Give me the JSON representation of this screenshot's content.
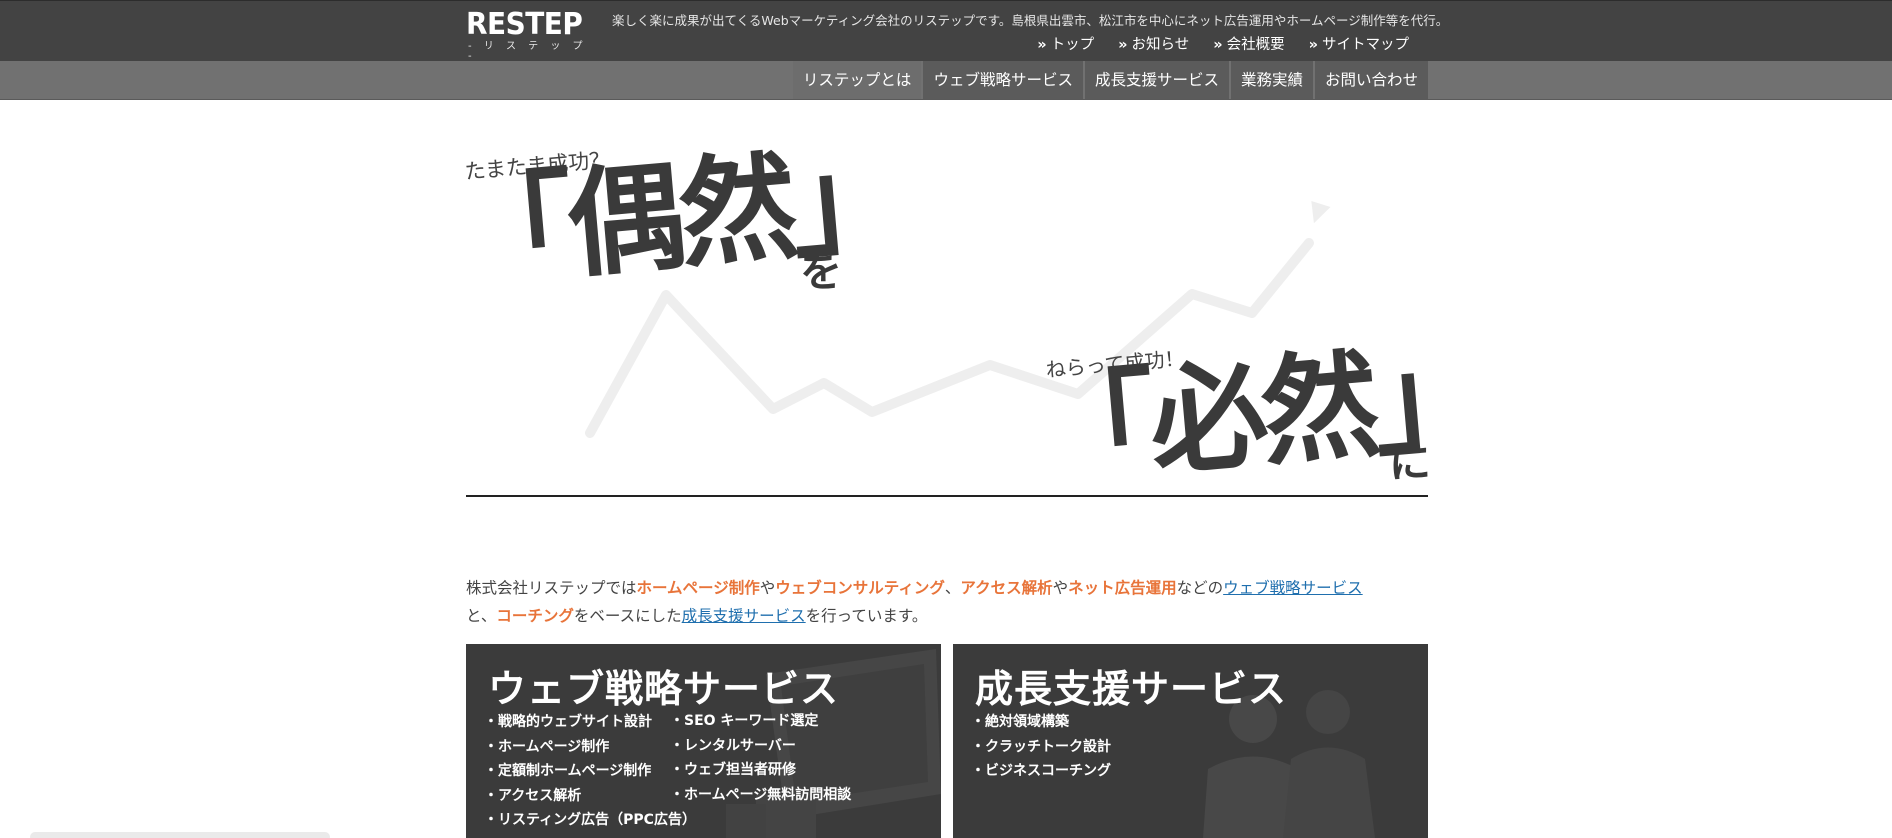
{
  "header": {
    "logo_main": "RESTEP",
    "logo_sub": "- リ ス テ ッ プ -",
    "tagline": "楽しく楽に成果が出てくるWebマーケティング会社のリステップです。島根県出雲市、松江市を中心にネット広告運用やホームページ制作等を代行。",
    "links": [
      {
        "label": "トップ"
      },
      {
        "label": "お知らせ"
      },
      {
        "label": "会社概要"
      },
      {
        "label": "サイトマップ"
      }
    ],
    "raquo": "»"
  },
  "nav": {
    "items": [
      {
        "label": "リステップとは"
      },
      {
        "label": "ウェブ戦略サービス"
      },
      {
        "label": "成長支援サービス"
      },
      {
        "label": "業務実績"
      },
      {
        "label": "お問い合わせ"
      }
    ]
  },
  "hero": {
    "lead1": "たまたま成功？",
    "big1": "「偶然」",
    "small1": "を",
    "lead2": "ねらって成功！",
    "big2": "「必然」",
    "small2": "に"
  },
  "intro": {
    "p1": "株式会社リステップでは",
    "hl1": "ホームページ制作",
    "p2": "や",
    "hl2": "ウェブコンサルティング",
    "p3": "、",
    "hl3": "アクセス解析",
    "p4": "や",
    "hl4": "ネット広告運用",
    "p5": "などの",
    "link1": "ウェブ戦略サービス",
    "p6": "と、",
    "hl5": "コーチング",
    "p7": "をベースにした",
    "link2": "成長支援サービス",
    "p8": "を行っています。"
  },
  "services": {
    "web": {
      "title": "ウェブ戦略サービス",
      "col1": [
        "戦略的ウェブサイト設計",
        "ホームページ制作",
        "定額制ホームページ制作",
        "アクセス解析",
        "リスティング広告（PPC広告）"
      ],
      "col2": [
        "SEO キーワード選定",
        "レンタルサーバー",
        "ウェブ担当者研修",
        "ホームページ無料訪問相談"
      ]
    },
    "growth": {
      "title": "成長支援サービス",
      "items": [
        "絶対領域構築",
        "クラッチトーク設計",
        "ビジネスコーチング"
      ]
    }
  },
  "colors": {
    "header_bg": "#434343",
    "nav_bg": "#717171",
    "highlight": "#e8743a",
    "link": "#1f6fae",
    "box_bg": "#3b3b3b"
  }
}
